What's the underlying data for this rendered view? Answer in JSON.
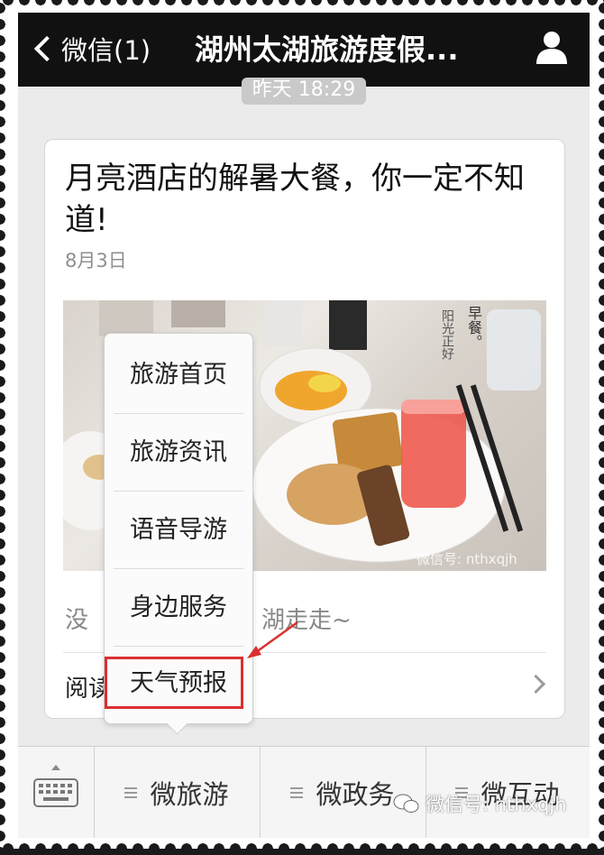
{
  "nav": {
    "back_label": "微信(1)",
    "title": "湖州太湖旅游度假..."
  },
  "chat": {
    "time_label": "昨天 18:29"
  },
  "article": {
    "title": "月亮酒店的解暑大餐，你一定不知道!",
    "date": "8月3日",
    "summary": "没",
    "summary_tail": "湖走走~",
    "read_more": "阅读",
    "image_text_1": "早餐。",
    "image_text_2": "阳光正好",
    "image_watermark": "微信号: nthxqjh"
  },
  "popup_menu": {
    "items": [
      {
        "label": "旅游首页"
      },
      {
        "label": "旅游资讯"
      },
      {
        "label": "语音导游"
      },
      {
        "label": "身边服务"
      },
      {
        "label": "天气预报"
      }
    ],
    "highlighted_item": "天气预报",
    "highlight_color": "#d9302f"
  },
  "bottom_menu": {
    "tabs": [
      {
        "label": "微旅游"
      },
      {
        "label": "微政务"
      },
      {
        "label": "微互动"
      }
    ]
  },
  "watermark": {
    "text": "微信号: nthxqjh"
  },
  "icons": {
    "back": "chevron-left-icon",
    "profile": "person-icon",
    "keyboard": "keyboard-icon",
    "menu": "hamburger-icon",
    "chevron_right": "chevron-right-icon"
  }
}
